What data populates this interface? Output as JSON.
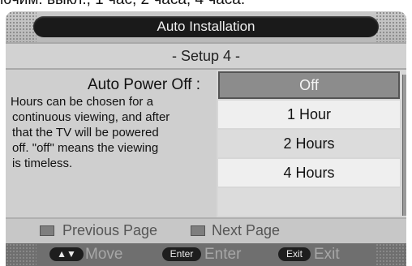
{
  "top_text": "ючим: выкл., 1 час, 2 часа, 4 часа.",
  "header": {
    "title": "Auto Installation"
  },
  "setup": {
    "label": "- Setup 4 -"
  },
  "description": {
    "title": "Auto Power Off :",
    "lines": [
      "Hours can be chosen for a",
      "continuous viewing, and after",
      "that the TV will be powered",
      "off. \"off\" means the viewing",
      "is timeless."
    ]
  },
  "options": [
    {
      "label": "Off",
      "selected": true
    },
    {
      "label": "1 Hour"
    },
    {
      "label": "2 Hours"
    },
    {
      "label": "4 Hours"
    },
    {
      "label": ""
    }
  ],
  "nav": {
    "previous": "Previous Page",
    "next": "Next Page"
  },
  "help": {
    "move_key": "▲▼",
    "move_label": "Move",
    "enter_key": "Enter",
    "enter_label": "Enter",
    "exit_key": "Exit",
    "exit_label": "Exit"
  },
  "colors": {
    "selected_bg": "#8c8c8c",
    "title_bg": "#1a1a1a",
    "help_bar_bg": "#6f6f6f"
  }
}
